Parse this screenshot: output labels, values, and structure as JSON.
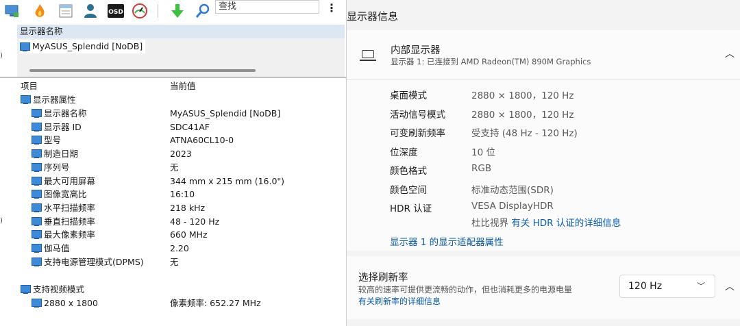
{
  "toolbar": {
    "search_placeholder": "查找",
    "icons": [
      "display-icon",
      "flame-icon",
      "calendar-icon",
      "user-icon",
      "osd-icon",
      "gauge-icon",
      "download-arrow-icon",
      "search-icon"
    ]
  },
  "edge_labels": [
    ")",
    ")"
  ],
  "device_panel": {
    "header": "显示器名称",
    "item": "MyASUS_Splendid [NoDB]"
  },
  "properties": {
    "col_item": "项目",
    "col_value": "当前值",
    "group1": "显示器属性",
    "rows": [
      {
        "label": "显示器名称",
        "value": "MyASUS_Splendid [NoDB]"
      },
      {
        "label": "显示器 ID",
        "value": "SDC41AF"
      },
      {
        "label": "型号",
        "value": "ATNA60CL10-0"
      },
      {
        "label": "制造日期",
        "value": "2023"
      },
      {
        "label": "序列号",
        "value": "无"
      },
      {
        "label": "最大可用屏幕",
        "value": "344 mm x 215 mm (16.0\")"
      },
      {
        "label": "图像宽高比",
        "value": "16:10"
      },
      {
        "label": "水平扫描频率",
        "value": "218 kHz"
      },
      {
        "label": "垂直扫描频率",
        "value": "48 - 120 Hz"
      },
      {
        "label": "最大像素频率",
        "value": "660 MHz"
      },
      {
        "label": "伽马值",
        "value": "2.20"
      },
      {
        "label": "支持电源管理模式(DPMS)",
        "value": "无"
      }
    ],
    "group2": "支持视频模式",
    "mode_row": {
      "label": "2880 x 1800",
      "value": "像素频率: 652.27 MHz"
    }
  },
  "settings": {
    "section_title": "显示器信息",
    "display_card": {
      "title": "内部显示器",
      "subtitle": "显示器 1: 已连接到 AMD Radeon(TM) 890M Graphics",
      "rows": [
        {
          "key": "桌面模式",
          "value": "2880 × 1800，120 Hz"
        },
        {
          "key": "活动信号模式",
          "value": "2880 × 1800，120 Hz"
        },
        {
          "key": "可变刷新频率",
          "value": "受支持 (48 Hz - 120 Hz)"
        },
        {
          "key": "位深度",
          "value": "10 位"
        },
        {
          "key": "颜色格式",
          "value": "RGB"
        },
        {
          "key": "颜色空间",
          "value": "标准动态范围(SDR)"
        },
        {
          "key": "HDR 认证",
          "value": "VESA DisplayHDR"
        }
      ],
      "dolby_text": "杜比视界",
      "hdr_link": "有关 HDR 认证的详细信息",
      "adapter_link": "显示器 1 的显示适配器属性"
    },
    "refresh_card": {
      "title": "选择刷新率",
      "subtitle": "较高的速率可提供更流畅的动作，但也消耗更多的电源电量",
      "link": "有关刷新率的详细信息",
      "selected": "120 Hz"
    }
  },
  "colors": {
    "accent": "#0b5cad",
    "tree_icon": "#3e8ad6"
  }
}
